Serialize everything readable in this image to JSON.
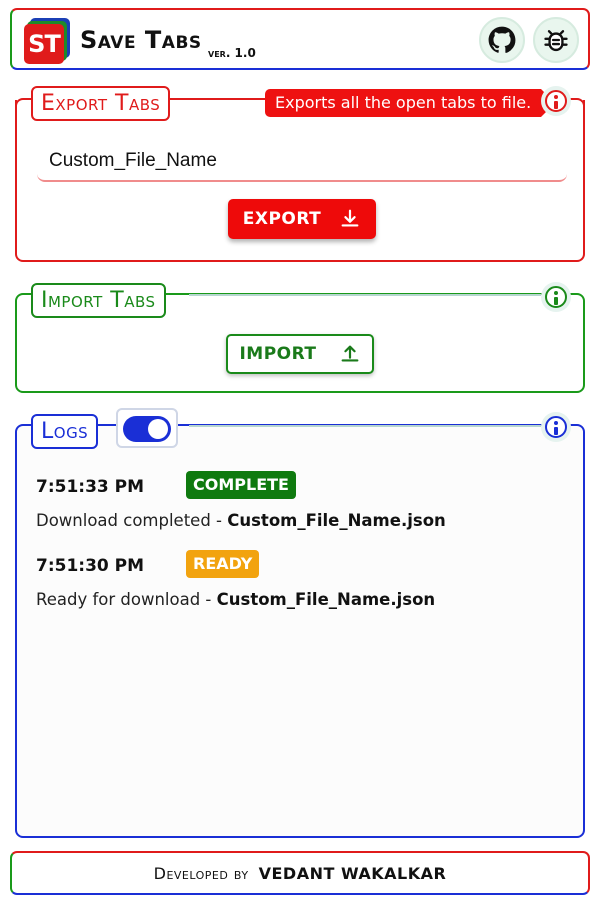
{
  "header": {
    "logo_text": "ST",
    "title": "Save Tabs",
    "version": "ver. 1.0",
    "github_icon": "github-icon",
    "bug_icon": "bug-icon"
  },
  "export": {
    "title": "Export Tabs",
    "tooltip": "Exports all the open tabs to file.",
    "file_name_value": "Custom_File_Name",
    "button_label": "EXPORT",
    "button_icon": "download-icon"
  },
  "import": {
    "title": "Import Tabs",
    "button_label": "IMPORT",
    "button_icon": "upload-icon"
  },
  "logs": {
    "title": "Logs",
    "toggle_on": true,
    "entries": [
      {
        "time": "7:51:33 PM",
        "status": "COMPLETE",
        "status_color": "#0f7a0f",
        "message": "Download completed - ",
        "file": "Custom_File_Name.json"
      },
      {
        "time": "7:51:30 PM",
        "status": "READY",
        "status_color": "#f2a30f",
        "message": "Ready for download - ",
        "file": "Custom_File_Name.json"
      }
    ]
  },
  "footer": {
    "developed_by": "Developed by",
    "author": "VEDANT WAKALKAR"
  },
  "colors": {
    "red": "#e01b1b",
    "green": "#1a8a1a",
    "blue": "#1a2fd6"
  }
}
